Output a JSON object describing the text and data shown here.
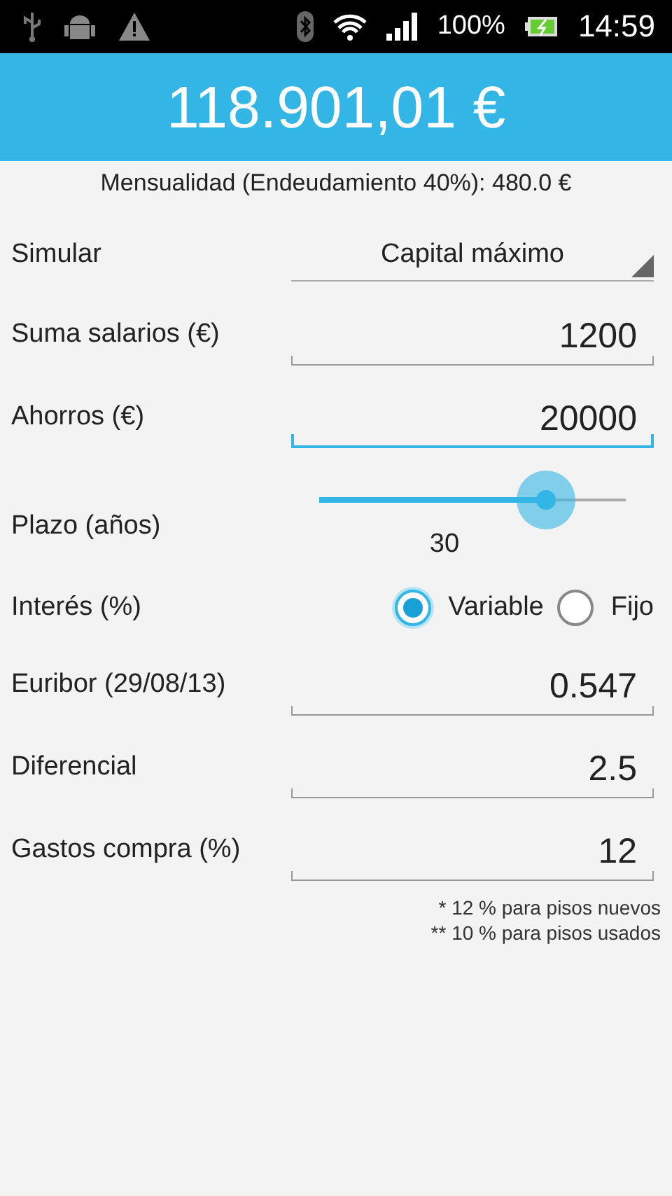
{
  "status_bar": {
    "battery_text": "100%",
    "time": "14:59"
  },
  "header": {
    "amount": "118.901,01 €"
  },
  "subtitle": "Mensualidad (Endeudamiento 40%): 480.0 €",
  "rows": [
    {
      "kind": "dropdown",
      "label": "Simular",
      "value": "Capital máximo"
    },
    {
      "kind": "field",
      "label": "Suma salarios (€)",
      "value": "1200",
      "focused": false
    },
    {
      "kind": "field",
      "label": "Ahorros (€)",
      "value": "20000",
      "focused": true
    },
    {
      "kind": "slider",
      "label": "Plazo (años)",
      "level": 0.74,
      "reading": "30"
    },
    {
      "kind": "radio",
      "label": "Interés (%)",
      "options": [
        {
          "label": "Variable",
          "selected": true
        },
        {
          "label": "Fijo",
          "selected": false
        }
      ]
    },
    {
      "kind": "field",
      "label": "Euribor (29/08/13)",
      "value": "0.547",
      "focused": false
    },
    {
      "kind": "field",
      "label": "Diferencial",
      "value": "2.5",
      "focused": false
    },
    {
      "kind": "field",
      "label": "Gastos compra (%)",
      "value": "12",
      "focused": false
    }
  ],
  "notes": [
    "* 12 % para pisos nuevos",
    "** 10 % para pisos usados"
  ]
}
